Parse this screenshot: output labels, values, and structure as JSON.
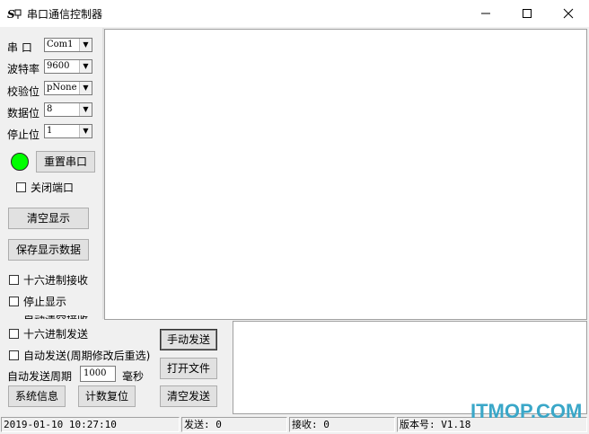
{
  "window": {
    "title": "串口通信控制器",
    "min_glyph": "—",
    "max_glyph": "☐",
    "close_glyph": "✕"
  },
  "serial": {
    "port_label": "串  口",
    "port_value": "Com1",
    "baud_label": "波特率",
    "baud_value": "9600",
    "parity_label": "校验位",
    "parity_value": "pNone",
    "databits_label": "数据位",
    "databits_value": "8",
    "stopbits_label": "停止位",
    "stopbits_value": "1",
    "reset_button": "重置串口",
    "close_port_checkbox": "关闭端口",
    "status_color": "#00ff00"
  },
  "display": {
    "clear_button": "清空显示",
    "save_button": "保存显示数据",
    "hex_receive": "十六进制接收",
    "stop_display": "停止显示",
    "auto_clear_partial": "自动清空接收"
  },
  "send": {
    "hex_send": "十六进制发送",
    "auto_send": "自动发送(周期修改后重选)",
    "period_label": "自动发送周期",
    "period_value": "1000",
    "period_unit": "毫秒",
    "manual_send_button": "手动发送",
    "open_file_button": "打开文件",
    "system_info_button": "系统信息",
    "reset_count_button": "计数复位",
    "clear_send_button": "清空发送"
  },
  "status": {
    "datetime": "2019-01-10 10:27:10",
    "sent": "发送: 0",
    "received": "接收: 0",
    "version": "版本号: V1.18"
  },
  "watermark": "ITMOP.COM",
  "icons": {
    "app": "serial-port-icon",
    "dropdown": "chevron-down-icon"
  }
}
